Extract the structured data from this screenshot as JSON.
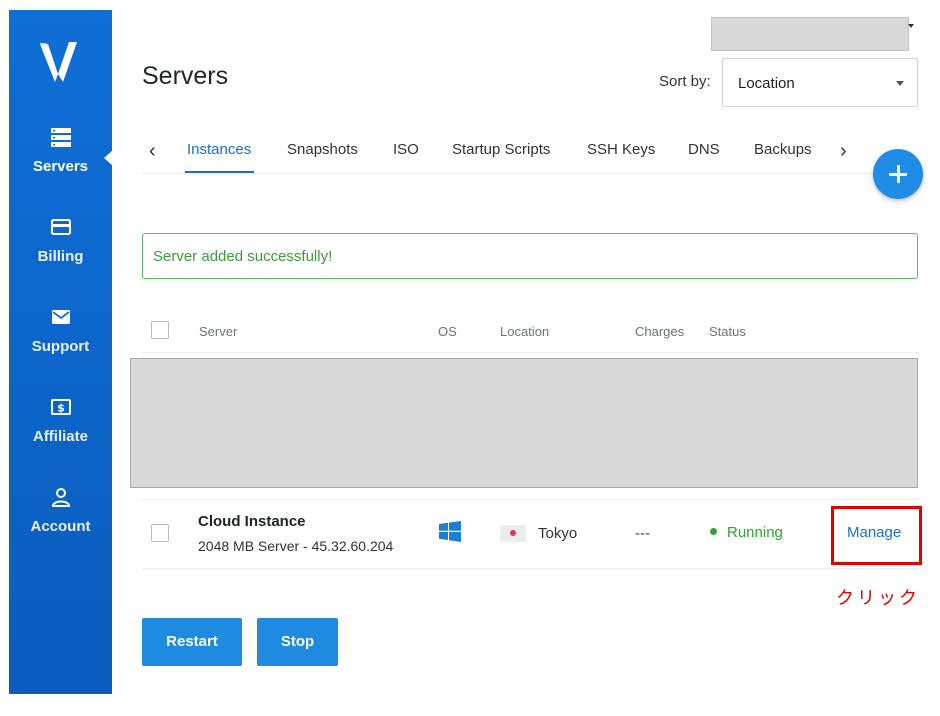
{
  "sidebar": {
    "logo_icon": "vultr-logo",
    "items": [
      {
        "label": "Servers",
        "icon": "servers-icon",
        "active": true
      },
      {
        "label": "Billing",
        "icon": "credit-card-icon",
        "active": false
      },
      {
        "label": "Support",
        "icon": "envelope-icon",
        "active": false
      },
      {
        "label": "Affiliate",
        "icon": "dollar-icon",
        "active": false
      },
      {
        "label": "Account",
        "icon": "user-icon",
        "active": false
      }
    ],
    "color": "#0f6fd7"
  },
  "header": {
    "title": "Servers",
    "sort_label": "Sort by:",
    "sort_value": "Location"
  },
  "tabs": {
    "items": [
      "Instances",
      "Snapshots",
      "ISO",
      "Startup Scripts",
      "SSH Keys",
      "DNS",
      "Backups"
    ],
    "active": "Instances",
    "prev_icon": "chevron-left-icon",
    "next_icon": "chevron-right-icon",
    "add_icon": "plus-icon"
  },
  "alert": {
    "message": "Server added successfully!"
  },
  "table": {
    "headers": {
      "server": "Server",
      "os": "OS",
      "location": "Location",
      "charges": "Charges",
      "status": "Status"
    },
    "rows": [
      {
        "name": "Cloud Instance",
        "description": "2048 MB Server - 45.32.60.204",
        "os_icon": "windows-icon",
        "location": "Tokyo",
        "flag": "japan-flag-icon",
        "charges": "---",
        "status": "Running",
        "action": "Manage"
      }
    ]
  },
  "annotation": "クリック",
  "buttons": {
    "restart": "Restart",
    "stop": "Stop"
  },
  "colors": {
    "accent": "#1470cc",
    "button": "#1e8ae0",
    "success": "#2fa12f",
    "highlight": "#e00000"
  }
}
